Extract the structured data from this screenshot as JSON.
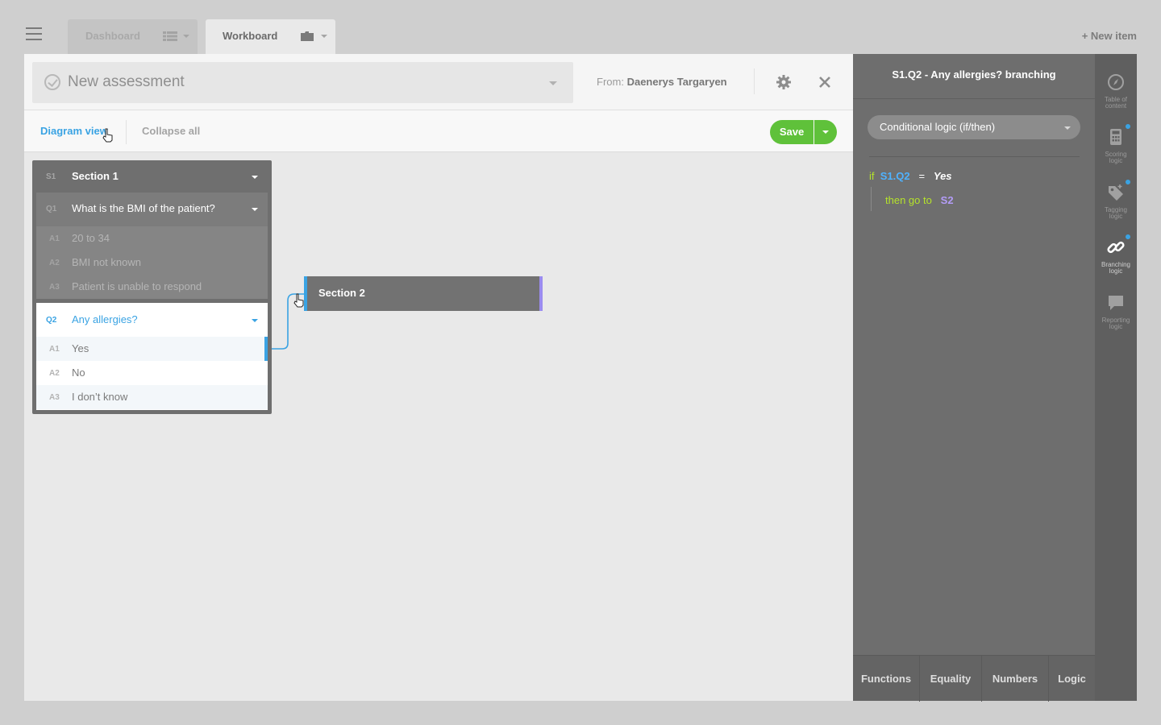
{
  "topbar": {
    "tabs": [
      {
        "label": "Dashboard"
      },
      {
        "label": "Workboard"
      }
    ],
    "new_item": "+ New item"
  },
  "header": {
    "assessment_title": "New assessment",
    "from_label": "From:",
    "from_name": "Daenerys Targaryen"
  },
  "toolbar": {
    "diagram_view": "Diagram view",
    "collapse_all": "Collapse all",
    "save": "Save"
  },
  "diagram": {
    "section1": {
      "code": "S1",
      "title": "Section 1",
      "q1": {
        "code": "Q1",
        "title": "What is the BMI of the patient?",
        "answers": [
          {
            "code": "A1",
            "text": "20 to 34"
          },
          {
            "code": "A2",
            "text": "BMI not known"
          },
          {
            "code": "A3",
            "text": "Patient is unable to respond"
          }
        ]
      },
      "q2": {
        "code": "Q2",
        "title": "Any allergies?",
        "answers": [
          {
            "code": "A1",
            "text": "Yes"
          },
          {
            "code": "A2",
            "text": "No"
          },
          {
            "code": "A3",
            "text": "I don’t know"
          }
        ]
      }
    },
    "section2": {
      "title": "Section 2"
    }
  },
  "panel": {
    "title": "S1.Q2 - Any allergies? branching",
    "logic_type": "Conditional logic (if/then)",
    "code": {
      "if": "if",
      "ref": "S1.Q2",
      "op": "=",
      "value": "Yes",
      "then": "then go to",
      "target": "S2"
    },
    "bottom_tabs": [
      "Functions",
      "Equality",
      "Numbers",
      "Logic"
    ]
  },
  "rail": [
    {
      "icon": "compass-icon",
      "label_1": "Table of",
      "label_2": "content"
    },
    {
      "icon": "calculator-icon",
      "label_1": "Scoring",
      "label_2": "logic"
    },
    {
      "icon": "tag-icon",
      "label_1": "Tagging",
      "label_2": "logic"
    },
    {
      "icon": "link-icon",
      "label_1": "Branching",
      "label_2": "logic"
    },
    {
      "icon": "comment-icon",
      "label_1": "Reporting",
      "label_2": "logic"
    }
  ],
  "colors": {
    "accent_blue": "#3aa3e3",
    "save_green": "#5fc13a",
    "keyword_green": "#b5e32b",
    "section_purple": "#b39cf7"
  }
}
